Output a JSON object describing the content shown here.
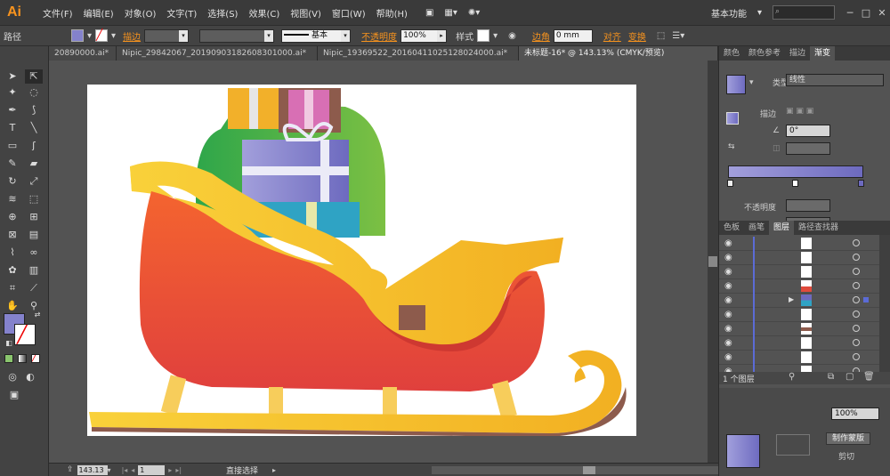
{
  "app": {
    "logo": "Ai"
  },
  "menu": [
    "文件(F)",
    "编辑(E)",
    "对象(O)",
    "文字(T)",
    "选择(S)",
    "效果(C)",
    "视图(V)",
    "窗口(W)",
    "帮助(H)"
  ],
  "menu_right": {
    "workspace": "基本功能",
    "minimize": "─",
    "maximize": "□",
    "close": "✕"
  },
  "control": {
    "selection_label": "路径",
    "stroke_label": "描边",
    "stroke_style": "基本",
    "opacity_label": "不透明度",
    "opacity_value": "100%",
    "style_label": "样式",
    "corner_label": "边角",
    "corner_value": "0 mm",
    "align_label": "对齐",
    "transform_label": "变换"
  },
  "tabs": [
    {
      "label": "20890000.ai*"
    },
    {
      "label": "Nipic_29842067_20190903182608301000.ai*"
    },
    {
      "label": "Nipic_19369522_20160411025128024000.ai*"
    },
    {
      "label": "未标题-16* @ 143.13% (CMYK/预览)"
    }
  ],
  "gradient_panel": {
    "tabs": [
      "颜色",
      "颜色参考",
      "描边",
      "渐变"
    ],
    "type_label": "类型",
    "type_value": "线性",
    "stroke_label": "描边",
    "angle_value": "0°",
    "opacity_label": "不透明度",
    "position_label": "位置",
    "colors": {
      "start": "#a29fdb",
      "end": "#6d6abf"
    }
  },
  "layers_panel": {
    "tabs": [
      "色板",
      "画笔",
      "图层",
      "路径查找器"
    ],
    "footer": "1 个图层",
    "row_count": 10
  },
  "bottom_panel": {
    "opacity_value": "100%",
    "make_mask": "制作蒙版",
    "clip": "剪切"
  },
  "status": {
    "zoom": "143.13",
    "page": "1",
    "tool": "直接选择"
  },
  "colors": {
    "fill": "#8482cc",
    "sleigh_red": "#ea4b3a",
    "sleigh_yellow": "#f7c52c",
    "bag_green": "#3fae4a"
  }
}
